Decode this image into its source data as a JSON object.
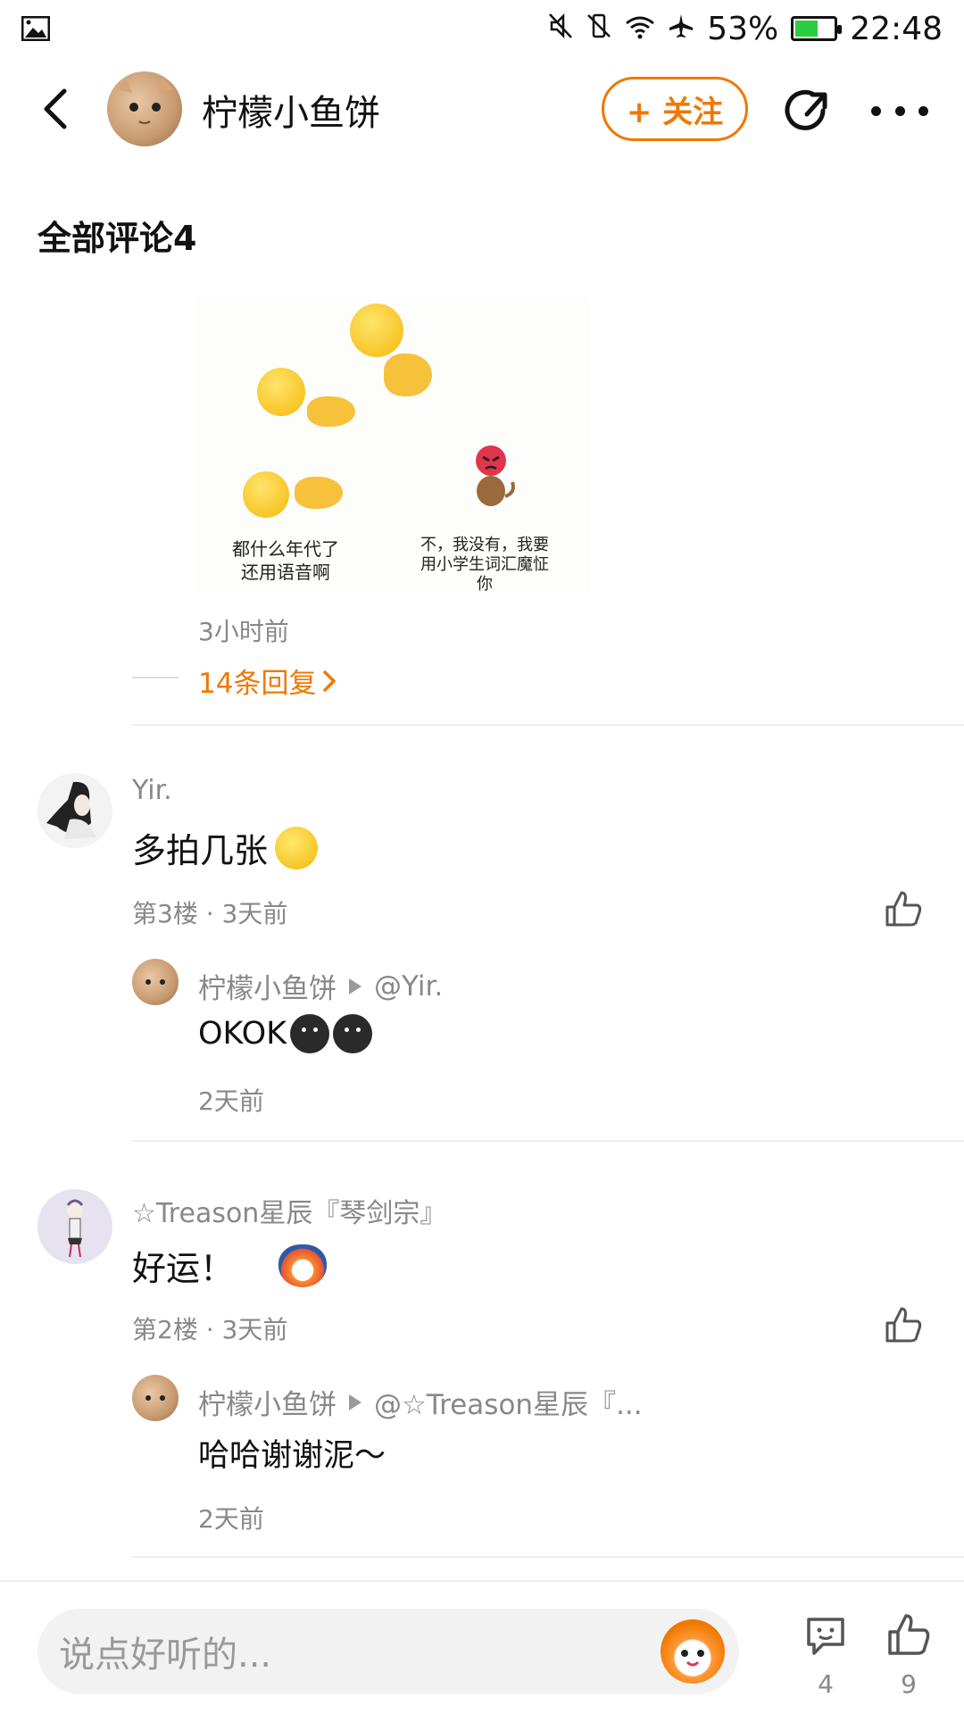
{
  "status_bar": {
    "battery": "53%",
    "time": "22:48",
    "battery_level": 0.53
  },
  "header": {
    "title": "柠檬小鱼饼",
    "follow_label": "+ 关注"
  },
  "section": {
    "title": "全部评论4"
  },
  "top_comment": {
    "image_captions": {
      "left": "都什么年代了\n还用语音啊",
      "right": "不，我没有，我要\n用小学生词汇魔怔\n你"
    },
    "time": "3小时前",
    "replies_link": "14条回复"
  },
  "comments": [
    {
      "user": "Yir.",
      "text": "多拍几张",
      "meta": "第3楼 · 3天前",
      "reply": {
        "user": "柠檬小鱼饼",
        "target": "@Yir.",
        "text": "OKOK",
        "time": "2天前"
      }
    },
    {
      "user": "☆Treason星辰『琴剑宗』",
      "text": "好运！",
      "meta": "第2楼 · 3天前",
      "reply": {
        "user": "柠檬小鱼饼",
        "target": "@☆Treason星辰『...",
        "text": "哈哈谢谢泥～",
        "time": "2天前"
      }
    }
  ],
  "bottom_bar": {
    "placeholder": "说点好听的...",
    "comment_count": "4",
    "like_count": "9"
  },
  "colors": {
    "accent": "#f07800",
    "muted": "#888888"
  }
}
